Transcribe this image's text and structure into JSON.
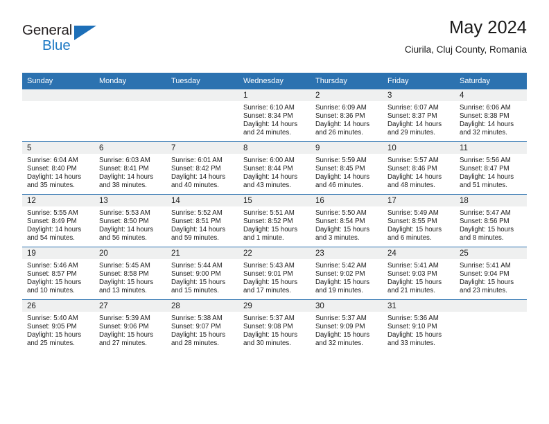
{
  "brand": {
    "name_top": "General",
    "name_bottom": "Blue",
    "accent_color": "#1d6fb8",
    "text_color": "#231f20"
  },
  "header": {
    "title": "May 2024",
    "subtitle": "Ciurila, Cluj County, Romania"
  },
  "theme": {
    "header_row_bg": "#2c72b0",
    "header_row_text": "#ffffff",
    "daynum_band_bg": "#eff0f0",
    "row_border": "#2c72b0",
    "cell_bg": "#ffffff"
  },
  "weekday_headers": [
    "Sunday",
    "Monday",
    "Tuesday",
    "Wednesday",
    "Thursday",
    "Friday",
    "Saturday"
  ],
  "labels": {
    "sunrise_prefix": "Sunrise:",
    "sunset_prefix": "Sunset:",
    "daylight_prefix": "Daylight:"
  },
  "weeks": [
    [
      {
        "day": "",
        "empty": true
      },
      {
        "day": "",
        "empty": true
      },
      {
        "day": "",
        "empty": true
      },
      {
        "day": "1",
        "sunrise": "Sunrise: 6:10 AM",
        "sunset": "Sunset: 8:34 PM",
        "daylight_line1": "Daylight: 14 hours",
        "daylight_line2": "and 24 minutes."
      },
      {
        "day": "2",
        "sunrise": "Sunrise: 6:09 AM",
        "sunset": "Sunset: 8:36 PM",
        "daylight_line1": "Daylight: 14 hours",
        "daylight_line2": "and 26 minutes."
      },
      {
        "day": "3",
        "sunrise": "Sunrise: 6:07 AM",
        "sunset": "Sunset: 8:37 PM",
        "daylight_line1": "Daylight: 14 hours",
        "daylight_line2": "and 29 minutes."
      },
      {
        "day": "4",
        "sunrise": "Sunrise: 6:06 AM",
        "sunset": "Sunset: 8:38 PM",
        "daylight_line1": "Daylight: 14 hours",
        "daylight_line2": "and 32 minutes."
      }
    ],
    [
      {
        "day": "5",
        "sunrise": "Sunrise: 6:04 AM",
        "sunset": "Sunset: 8:40 PM",
        "daylight_line1": "Daylight: 14 hours",
        "daylight_line2": "and 35 minutes."
      },
      {
        "day": "6",
        "sunrise": "Sunrise: 6:03 AM",
        "sunset": "Sunset: 8:41 PM",
        "daylight_line1": "Daylight: 14 hours",
        "daylight_line2": "and 38 minutes."
      },
      {
        "day": "7",
        "sunrise": "Sunrise: 6:01 AM",
        "sunset": "Sunset: 8:42 PM",
        "daylight_line1": "Daylight: 14 hours",
        "daylight_line2": "and 40 minutes."
      },
      {
        "day": "8",
        "sunrise": "Sunrise: 6:00 AM",
        "sunset": "Sunset: 8:44 PM",
        "daylight_line1": "Daylight: 14 hours",
        "daylight_line2": "and 43 minutes."
      },
      {
        "day": "9",
        "sunrise": "Sunrise: 5:59 AM",
        "sunset": "Sunset: 8:45 PM",
        "daylight_line1": "Daylight: 14 hours",
        "daylight_line2": "and 46 minutes."
      },
      {
        "day": "10",
        "sunrise": "Sunrise: 5:57 AM",
        "sunset": "Sunset: 8:46 PM",
        "daylight_line1": "Daylight: 14 hours",
        "daylight_line2": "and 48 minutes."
      },
      {
        "day": "11",
        "sunrise": "Sunrise: 5:56 AM",
        "sunset": "Sunset: 8:47 PM",
        "daylight_line1": "Daylight: 14 hours",
        "daylight_line2": "and 51 minutes."
      }
    ],
    [
      {
        "day": "12",
        "sunrise": "Sunrise: 5:55 AM",
        "sunset": "Sunset: 8:49 PM",
        "daylight_line1": "Daylight: 14 hours",
        "daylight_line2": "and 54 minutes."
      },
      {
        "day": "13",
        "sunrise": "Sunrise: 5:53 AM",
        "sunset": "Sunset: 8:50 PM",
        "daylight_line1": "Daylight: 14 hours",
        "daylight_line2": "and 56 minutes."
      },
      {
        "day": "14",
        "sunrise": "Sunrise: 5:52 AM",
        "sunset": "Sunset: 8:51 PM",
        "daylight_line1": "Daylight: 14 hours",
        "daylight_line2": "and 59 minutes."
      },
      {
        "day": "15",
        "sunrise": "Sunrise: 5:51 AM",
        "sunset": "Sunset: 8:52 PM",
        "daylight_line1": "Daylight: 15 hours",
        "daylight_line2": "and 1 minute."
      },
      {
        "day": "16",
        "sunrise": "Sunrise: 5:50 AM",
        "sunset": "Sunset: 8:54 PM",
        "daylight_line1": "Daylight: 15 hours",
        "daylight_line2": "and 3 minutes."
      },
      {
        "day": "17",
        "sunrise": "Sunrise: 5:49 AM",
        "sunset": "Sunset: 8:55 PM",
        "daylight_line1": "Daylight: 15 hours",
        "daylight_line2": "and 6 minutes."
      },
      {
        "day": "18",
        "sunrise": "Sunrise: 5:47 AM",
        "sunset": "Sunset: 8:56 PM",
        "daylight_line1": "Daylight: 15 hours",
        "daylight_line2": "and 8 minutes."
      }
    ],
    [
      {
        "day": "19",
        "sunrise": "Sunrise: 5:46 AM",
        "sunset": "Sunset: 8:57 PM",
        "daylight_line1": "Daylight: 15 hours",
        "daylight_line2": "and 10 minutes."
      },
      {
        "day": "20",
        "sunrise": "Sunrise: 5:45 AM",
        "sunset": "Sunset: 8:58 PM",
        "daylight_line1": "Daylight: 15 hours",
        "daylight_line2": "and 13 minutes."
      },
      {
        "day": "21",
        "sunrise": "Sunrise: 5:44 AM",
        "sunset": "Sunset: 9:00 PM",
        "daylight_line1": "Daylight: 15 hours",
        "daylight_line2": "and 15 minutes."
      },
      {
        "day": "22",
        "sunrise": "Sunrise: 5:43 AM",
        "sunset": "Sunset: 9:01 PM",
        "daylight_line1": "Daylight: 15 hours",
        "daylight_line2": "and 17 minutes."
      },
      {
        "day": "23",
        "sunrise": "Sunrise: 5:42 AM",
        "sunset": "Sunset: 9:02 PM",
        "daylight_line1": "Daylight: 15 hours",
        "daylight_line2": "and 19 minutes."
      },
      {
        "day": "24",
        "sunrise": "Sunrise: 5:41 AM",
        "sunset": "Sunset: 9:03 PM",
        "daylight_line1": "Daylight: 15 hours",
        "daylight_line2": "and 21 minutes."
      },
      {
        "day": "25",
        "sunrise": "Sunrise: 5:41 AM",
        "sunset": "Sunset: 9:04 PM",
        "daylight_line1": "Daylight: 15 hours",
        "daylight_line2": "and 23 minutes."
      }
    ],
    [
      {
        "day": "26",
        "sunrise": "Sunrise: 5:40 AM",
        "sunset": "Sunset: 9:05 PM",
        "daylight_line1": "Daylight: 15 hours",
        "daylight_line2": "and 25 minutes."
      },
      {
        "day": "27",
        "sunrise": "Sunrise: 5:39 AM",
        "sunset": "Sunset: 9:06 PM",
        "daylight_line1": "Daylight: 15 hours",
        "daylight_line2": "and 27 minutes."
      },
      {
        "day": "28",
        "sunrise": "Sunrise: 5:38 AM",
        "sunset": "Sunset: 9:07 PM",
        "daylight_line1": "Daylight: 15 hours",
        "daylight_line2": "and 28 minutes."
      },
      {
        "day": "29",
        "sunrise": "Sunrise: 5:37 AM",
        "sunset": "Sunset: 9:08 PM",
        "daylight_line1": "Daylight: 15 hours",
        "daylight_line2": "and 30 minutes."
      },
      {
        "day": "30",
        "sunrise": "Sunrise: 5:37 AM",
        "sunset": "Sunset: 9:09 PM",
        "daylight_line1": "Daylight: 15 hours",
        "daylight_line2": "and 32 minutes."
      },
      {
        "day": "31",
        "sunrise": "Sunrise: 5:36 AM",
        "sunset": "Sunset: 9:10 PM",
        "daylight_line1": "Daylight: 15 hours",
        "daylight_line2": "and 33 minutes."
      },
      {
        "day": "",
        "empty": true
      }
    ]
  ]
}
